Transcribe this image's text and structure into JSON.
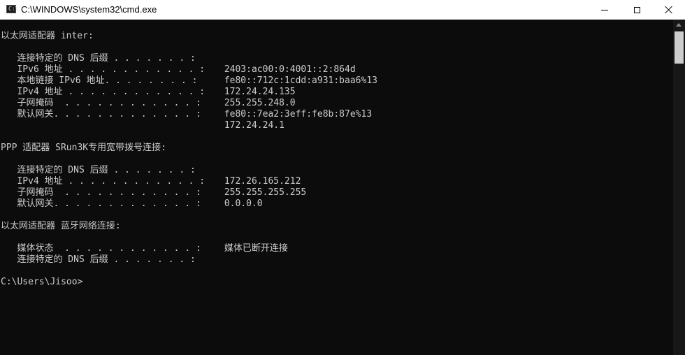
{
  "window": {
    "title": "C:\\WINDOWS\\system32\\cmd.exe"
  },
  "console": {
    "sec1_header": "以太网适配器 inter:",
    "sec1": [
      {
        "label": "   连接特定的 DNS 后缀 . . . . . . . :",
        "value": ""
      },
      {
        "label": "   IPv6 地址 . . . . . . . . . . . . :",
        "value": " 2403:ac00:0:4001::2:864d"
      },
      {
        "label": "   本地链接 IPv6 地址. . . . . . . . :",
        "value": " fe80::712c:1cdd:a931:baa6%13"
      },
      {
        "label": "   IPv4 地址 . . . . . . . . . . . . :",
        "value": " 172.24.24.135"
      },
      {
        "label": "   子网掩码  . . . . . . . . . . . . :",
        "value": " 255.255.248.0"
      },
      {
        "label": "   默认网关. . . . . . . . . . . . . :",
        "value": " fe80::7ea2:3eff:fe8b:87e%13"
      },
      {
        "label": "",
        "value": " 172.24.24.1"
      }
    ],
    "sec2_header": "PPP 适配器 SRun3K专用宽带拨号连接:",
    "sec2": [
      {
        "label": "   连接特定的 DNS 后缀 . . . . . . . :",
        "value": ""
      },
      {
        "label": "   IPv4 地址 . . . . . . . . . . . . :",
        "value": " 172.26.165.212"
      },
      {
        "label": "   子网掩码  . . . . . . . . . . . . :",
        "value": " 255.255.255.255"
      },
      {
        "label": "   默认网关. . . . . . . . . . . . . :",
        "value": " 0.0.0.0"
      }
    ],
    "sec3_header": "以太网适配器 蓝牙网络连接:",
    "sec3": [
      {
        "label": "   媒体状态  . . . . . . . . . . . . :",
        "value": " 媒体已断开连接"
      },
      {
        "label": "   连接特定的 DNS 后缀 . . . . . . . :",
        "value": ""
      }
    ],
    "prompt": "C:\\Users\\Jisoo>"
  }
}
